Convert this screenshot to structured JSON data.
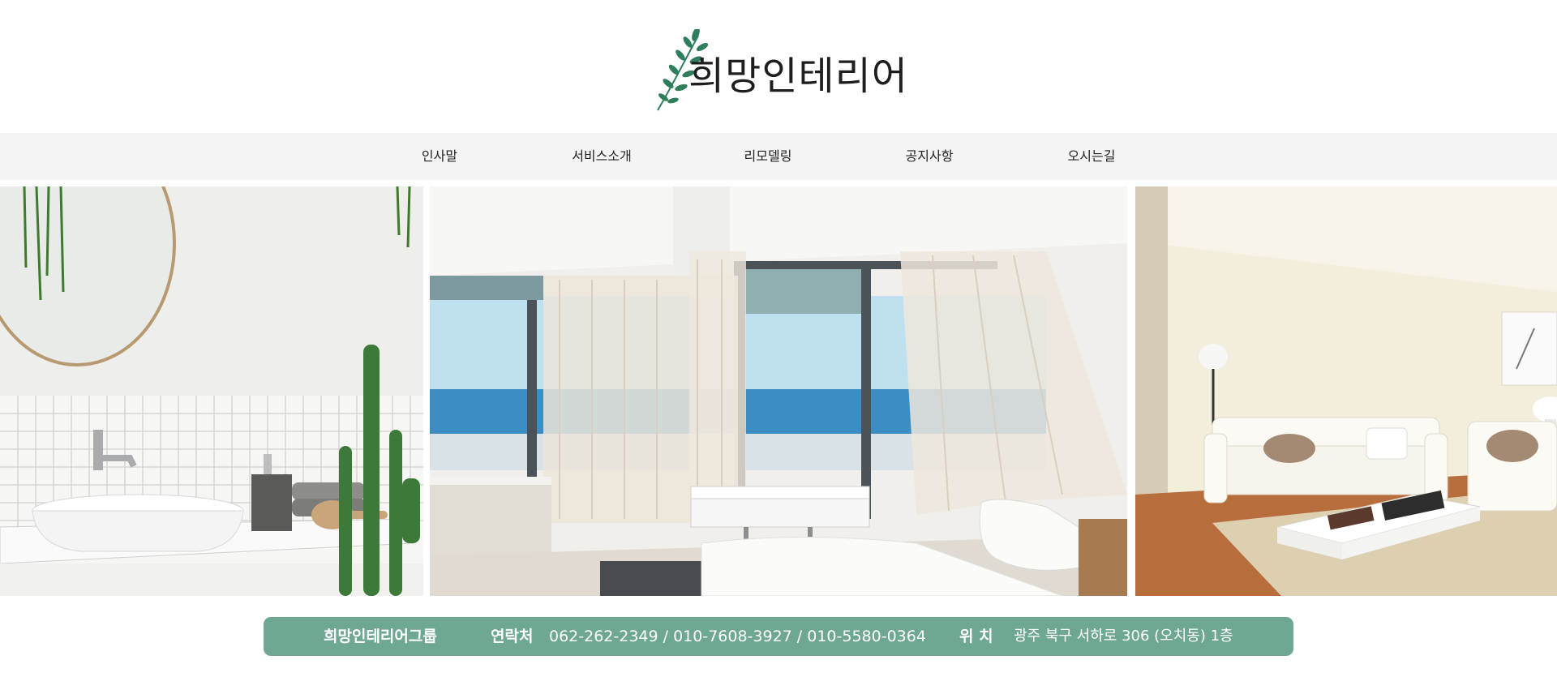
{
  "header": {
    "logo_text": "희망인테리어"
  },
  "nav": {
    "items": [
      "인사말",
      "서비스소개",
      "리모델링",
      "공지사항",
      "오시는길"
    ]
  },
  "gallery": {
    "photos": [
      "bathroom-photo",
      "ocean-bedroom-photo",
      "living-room-photo"
    ]
  },
  "footer": {
    "company": "희망인테리어그룹",
    "contact_label": "연락처",
    "phones": "062-262-2349 / 010-7608-3927 / 010-5580-0364",
    "location_label": "위 치",
    "address": "광주 북구 서하로 306 (오치동) 1층"
  },
  "colors": {
    "accent": "#6fa892",
    "nav_bg": "#f4f4f4",
    "leaf": "#2e7d5b"
  }
}
